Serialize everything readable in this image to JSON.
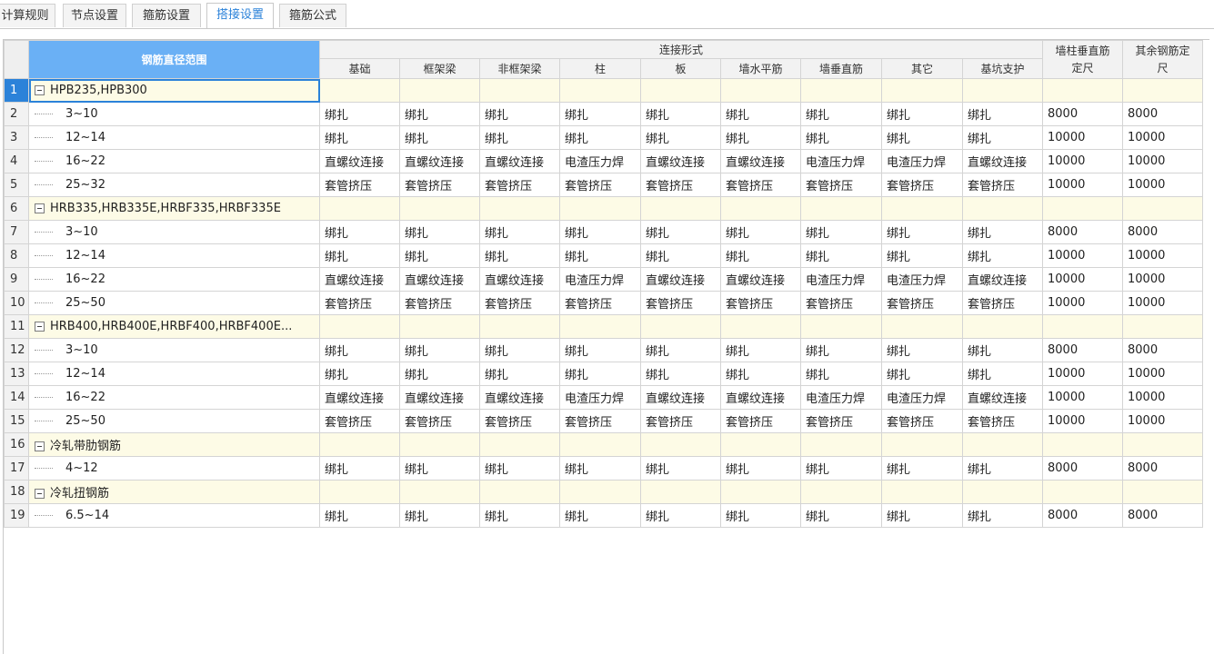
{
  "tabs": [
    {
      "label": "计算规则",
      "active": false
    },
    {
      "label": "节点设置",
      "active": false
    },
    {
      "label": "箍筋设置",
      "active": false
    },
    {
      "label": "搭接设置",
      "active": true
    },
    {
      "label": "箍筋公式",
      "active": false
    }
  ],
  "header": {
    "diameter_range": "钢筋直径范围",
    "connection_form": "连接形式",
    "sub_columns": [
      "基础",
      "框架梁",
      "非框架梁",
      "柱",
      "板",
      "墙水平筋",
      "墙垂直筋",
      "其它",
      "基坑支护"
    ],
    "wall_col_fixed_line1": "墙柱垂直筋",
    "wall_col_fixed_line2": "定尺",
    "other_fixed_line1": "其余钢筋定",
    "other_fixed_line2": "尺"
  },
  "rows": [
    {
      "num": "1",
      "name": "HPB235,HPB300",
      "group": true,
      "cells": [
        "",
        "",
        "",
        "",
        "",
        "",
        "",
        "",
        "",
        "",
        ""
      ]
    },
    {
      "num": "2",
      "name": "3~10",
      "group": false,
      "cells": [
        "绑扎",
        "绑扎",
        "绑扎",
        "绑扎",
        "绑扎",
        "绑扎",
        "绑扎",
        "绑扎",
        "绑扎",
        "8000",
        "8000"
      ]
    },
    {
      "num": "3",
      "name": "12~14",
      "group": false,
      "cells": [
        "绑扎",
        "绑扎",
        "绑扎",
        "绑扎",
        "绑扎",
        "绑扎",
        "绑扎",
        "绑扎",
        "绑扎",
        "10000",
        "10000"
      ]
    },
    {
      "num": "4",
      "name": "16~22",
      "group": false,
      "cells": [
        "直螺纹连接",
        "直螺纹连接",
        "直螺纹连接",
        "电渣压力焊",
        "直螺纹连接",
        "直螺纹连接",
        "电渣压力焊",
        "电渣压力焊",
        "直螺纹连接",
        "10000",
        "10000"
      ]
    },
    {
      "num": "5",
      "name": "25~32",
      "group": false,
      "cells": [
        "套管挤压",
        "套管挤压",
        "套管挤压",
        "套管挤压",
        "套管挤压",
        "套管挤压",
        "套管挤压",
        "套管挤压",
        "套管挤压",
        "10000",
        "10000"
      ]
    },
    {
      "num": "6",
      "name": "HRB335,HRB335E,HRBF335,HRBF335E",
      "group": true,
      "cells": [
        "",
        "",
        "",
        "",
        "",
        "",
        "",
        "",
        "",
        "",
        ""
      ]
    },
    {
      "num": "7",
      "name": "3~10",
      "group": false,
      "cells": [
        "绑扎",
        "绑扎",
        "绑扎",
        "绑扎",
        "绑扎",
        "绑扎",
        "绑扎",
        "绑扎",
        "绑扎",
        "8000",
        "8000"
      ]
    },
    {
      "num": "8",
      "name": "12~14",
      "group": false,
      "cells": [
        "绑扎",
        "绑扎",
        "绑扎",
        "绑扎",
        "绑扎",
        "绑扎",
        "绑扎",
        "绑扎",
        "绑扎",
        "10000",
        "10000"
      ]
    },
    {
      "num": "9",
      "name": "16~22",
      "group": false,
      "cells": [
        "直螺纹连接",
        "直螺纹连接",
        "直螺纹连接",
        "电渣压力焊",
        "直螺纹连接",
        "直螺纹连接",
        "电渣压力焊",
        "电渣压力焊",
        "直螺纹连接",
        "10000",
        "10000"
      ]
    },
    {
      "num": "10",
      "name": "25~50",
      "group": false,
      "cells": [
        "套管挤压",
        "套管挤压",
        "套管挤压",
        "套管挤压",
        "套管挤压",
        "套管挤压",
        "套管挤压",
        "套管挤压",
        "套管挤压",
        "10000",
        "10000"
      ]
    },
    {
      "num": "11",
      "name": "HRB400,HRB400E,HRBF400,HRBF400E...",
      "group": true,
      "cells": [
        "",
        "",
        "",
        "",
        "",
        "",
        "",
        "",
        "",
        "",
        ""
      ]
    },
    {
      "num": "12",
      "name": "3~10",
      "group": false,
      "cells": [
        "绑扎",
        "绑扎",
        "绑扎",
        "绑扎",
        "绑扎",
        "绑扎",
        "绑扎",
        "绑扎",
        "绑扎",
        "8000",
        "8000"
      ]
    },
    {
      "num": "13",
      "name": "12~14",
      "group": false,
      "cells": [
        "绑扎",
        "绑扎",
        "绑扎",
        "绑扎",
        "绑扎",
        "绑扎",
        "绑扎",
        "绑扎",
        "绑扎",
        "10000",
        "10000"
      ]
    },
    {
      "num": "14",
      "name": "16~22",
      "group": false,
      "cells": [
        "直螺纹连接",
        "直螺纹连接",
        "直螺纹连接",
        "电渣压力焊",
        "直螺纹连接",
        "直螺纹连接",
        "电渣压力焊",
        "电渣压力焊",
        "直螺纹连接",
        "10000",
        "10000"
      ]
    },
    {
      "num": "15",
      "name": "25~50",
      "group": false,
      "cells": [
        "套管挤压",
        "套管挤压",
        "套管挤压",
        "套管挤压",
        "套管挤压",
        "套管挤压",
        "套管挤压",
        "套管挤压",
        "套管挤压",
        "10000",
        "10000"
      ]
    },
    {
      "num": "16",
      "name": "冷轧带肋钢筋",
      "group": true,
      "cells": [
        "",
        "",
        "",
        "",
        "",
        "",
        "",
        "",
        "",
        "",
        ""
      ]
    },
    {
      "num": "17",
      "name": "4~12",
      "group": false,
      "cells": [
        "绑扎",
        "绑扎",
        "绑扎",
        "绑扎",
        "绑扎",
        "绑扎",
        "绑扎",
        "绑扎",
        "绑扎",
        "8000",
        "8000"
      ]
    },
    {
      "num": "18",
      "name": "冷轧扭钢筋",
      "group": true,
      "cells": [
        "",
        "",
        "",
        "",
        "",
        "",
        "",
        "",
        "",
        "",
        ""
      ]
    },
    {
      "num": "19",
      "name": "6.5~14",
      "group": false,
      "cells": [
        "绑扎",
        "绑扎",
        "绑扎",
        "绑扎",
        "绑扎",
        "绑扎",
        "绑扎",
        "绑扎",
        "绑扎",
        "8000",
        "8000"
      ]
    }
  ],
  "colors": {
    "accent": "#2b82d9",
    "header_selected": "#6ab0f5",
    "group_row": "#fdfbe6"
  }
}
